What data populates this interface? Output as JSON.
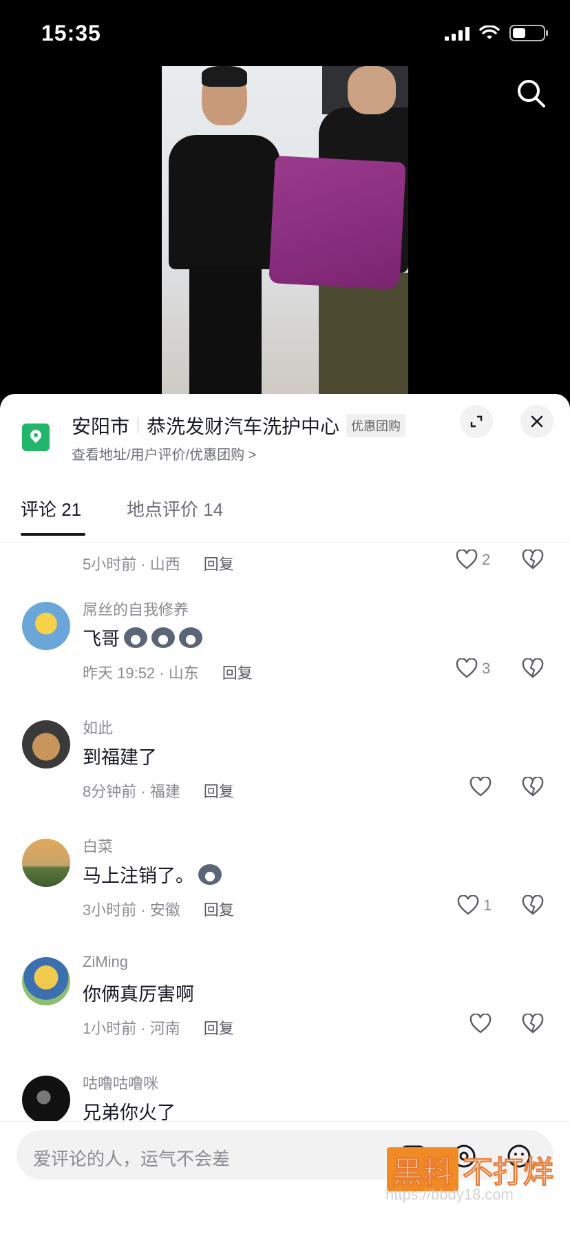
{
  "status": {
    "time": "15:35"
  },
  "location": {
    "city": "安阳市",
    "name": "恭洗发财汽车洗护中心",
    "tag": "优惠团购",
    "links": "查看地址/用户评价/优惠团购 >"
  },
  "tabs": [
    {
      "label": "评论 21",
      "active": true
    },
    {
      "label": "地点评价 14",
      "active": false
    }
  ],
  "partial_comment": {
    "meta": "5小时前 · 山西",
    "reply": "回复",
    "likes": "2"
  },
  "comments": [
    {
      "user": "屌丝的自我修养",
      "text": "飞哥",
      "emojis": 3,
      "meta": "昨天 19:52 · 山东",
      "reply": "回复",
      "likes": "3"
    },
    {
      "user": "如此",
      "text": "到福建了",
      "emojis": 0,
      "meta": "8分钟前 · 福建",
      "reply": "回复",
      "likes": ""
    },
    {
      "user": "白菜",
      "text": "马上注销了。",
      "emojis": 1,
      "meta": "3小时前 · 安徽",
      "reply": "回复",
      "likes": "1"
    },
    {
      "user": "ZiMing",
      "text": "你俩真厉害啊",
      "emojis": 0,
      "meta": "1小时前 · 河南",
      "reply": "回复",
      "likes": ""
    },
    {
      "user": "咕噜咕噜咪",
      "text": "兄弟你火了",
      "emojis": 0,
      "meta": "",
      "reply": "",
      "likes": ""
    }
  ],
  "input": {
    "placeholder": "爱评论的人，运气不会差"
  },
  "watermark": {
    "badge": "黑料",
    "text": "不打烊",
    "url": "https://bbdy18.com"
  },
  "colors": {
    "accent_green": "#21b66a",
    "text_primary": "#161823",
    "text_secondary": "#8a8b91"
  }
}
